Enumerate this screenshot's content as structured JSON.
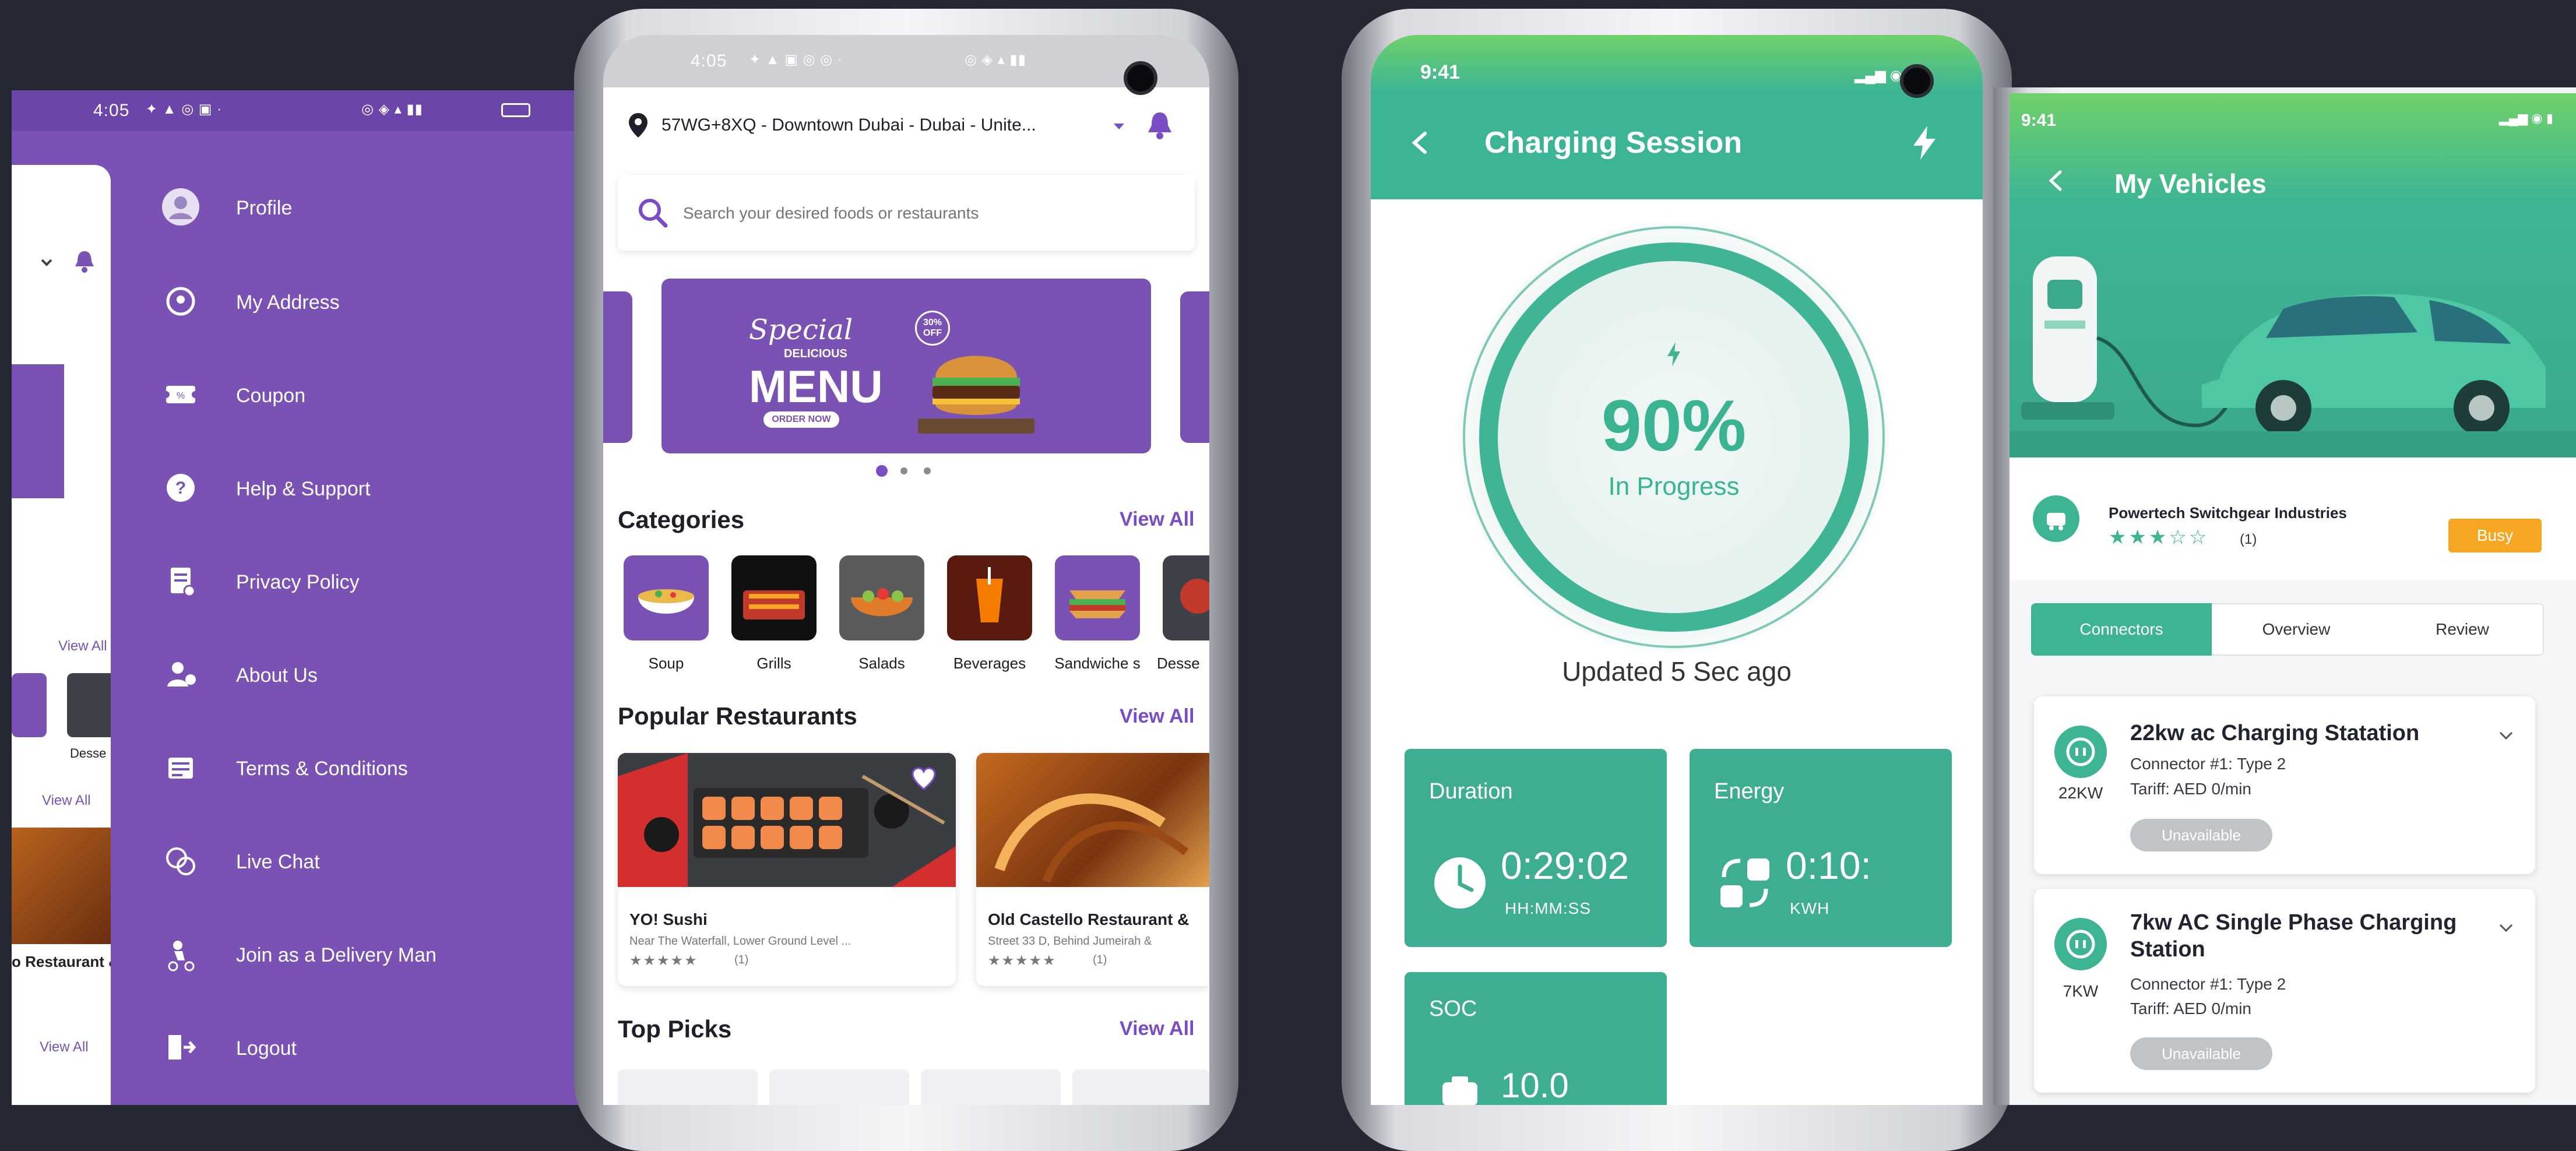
{
  "drawer_phone": {
    "status_time": "4:05",
    "view_all_labels": [
      "View All",
      "View All",
      "View All"
    ],
    "partial_labels": [
      "Desse",
      "o Restaurant &"
    ],
    "menu_items": [
      {
        "label": "Profile",
        "icon": "profile-avatar-icon"
      },
      {
        "label": "My Address",
        "icon": "location-pin-icon"
      },
      {
        "label": "Coupon",
        "icon": "coupon-icon"
      },
      {
        "label": "Help & Support",
        "icon": "help-icon"
      },
      {
        "label": "Privacy Policy",
        "icon": "privacy-policy-icon"
      },
      {
        "label": "About Us",
        "icon": "about-us-icon"
      },
      {
        "label": "Terms & Conditions",
        "icon": "terms-icon"
      },
      {
        "label": "Live Chat",
        "icon": "chat-icon"
      },
      {
        "label": "Join as a Delivery Man",
        "icon": "delivery-man-icon"
      },
      {
        "label": "Logout",
        "icon": "logout-icon"
      }
    ],
    "colors": {
      "drawer_bg": "#7a52b3",
      "status_bar": "#6b45a8"
    }
  },
  "food_phone": {
    "status_time": "4:05",
    "address": "57WG+8XQ - Downtown Dubai - Dubai - Unite...",
    "search_placeholder": "Search your desired foods or restaurants",
    "banner": {
      "script_text": "Special",
      "small_text": "DELICIOUS",
      "title": "MENU",
      "badge": "30% OFF",
      "button": "ORDER NOW"
    },
    "categories_title": "Categories",
    "categories_view_all": "View All",
    "categories": [
      {
        "label": "Soup",
        "bg": "#7a52b3"
      },
      {
        "label": "Grills",
        "bg": "#111111"
      },
      {
        "label": "Salads",
        "bg": "#5a5a5a"
      },
      {
        "label": "Beverages",
        "bg": "#5a1a10"
      },
      {
        "label": "Sandwiche s",
        "bg": "#7a52b3"
      },
      {
        "label": "Desse",
        "bg": "#3e4148"
      }
    ],
    "popular_title": "Popular Restaurants",
    "popular_view_all": "View All",
    "restaurants": [
      {
        "name": "YO! Sushi",
        "address": "Near The Waterfall, Lower Ground Level ...",
        "rating_count": "(1)"
      },
      {
        "name": "Old Castello Restaurant &",
        "address": "Street 33 D, Behind Jumeirah &",
        "rating_count": "(1)"
      }
    ],
    "top_picks_title": "Top Picks",
    "top_picks_view_all": "View All",
    "colors": {
      "accent": "#7a4cc6"
    }
  },
  "charging_phone": {
    "status_time": "9:41",
    "title": "Charging Session",
    "percent": "90%",
    "status": "In Progress",
    "updated": "Updated 5 Sec ago",
    "stats": [
      {
        "title": "Duration",
        "value": "0:29:02",
        "unit": "HH:MM:SS"
      },
      {
        "title": "Energy",
        "value": "0:10:",
        "unit": "KWH"
      },
      {
        "title": "SOC",
        "value": "10.0",
        "unit": ""
      }
    ],
    "colors": {
      "header": "#3cb597",
      "ring": "#3fb596",
      "card": "#3dae92"
    }
  },
  "vehicles_phone": {
    "status_time": "9:41",
    "title": "My Vehicles",
    "company": "Powertech Switchgear Industries",
    "rating_count": "(1)",
    "stars_filled": 3,
    "status_badge": "Busy",
    "tabs": [
      "Connectors",
      "Overview",
      "Review"
    ],
    "active_tab": 0,
    "connectors": [
      {
        "title": "22kw ac Charging Statation",
        "power": "22KW",
        "connector": "Connector #1: Type 2",
        "tariff": "Tariff: AED 0/min",
        "status": "Unavailable"
      },
      {
        "title": "7kw AC Single Phase Charging Station",
        "power": "7KW",
        "connector": "Connector #1: Type 2",
        "tariff": "Tariff: AED 0/min",
        "status": "Unavailable"
      }
    ],
    "colors": {
      "header": "#3db594",
      "busy": "#f5a623",
      "tab_active": "#3db594"
    }
  }
}
